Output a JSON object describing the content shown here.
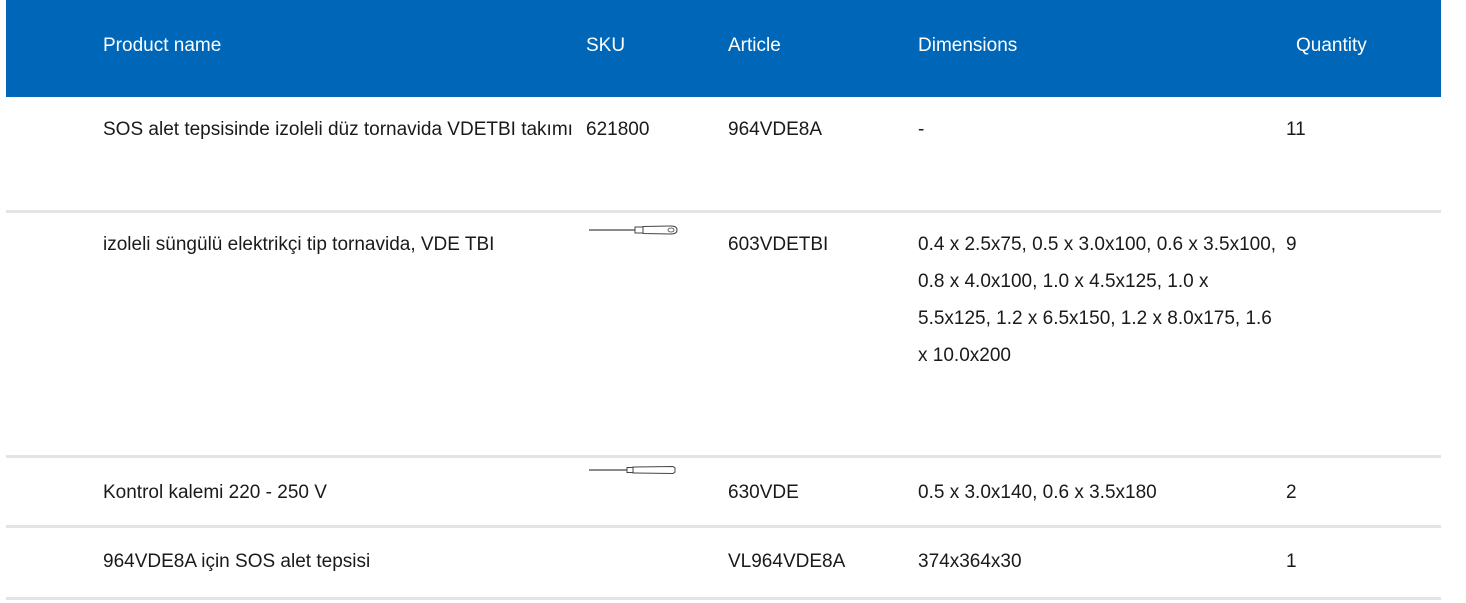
{
  "header": {
    "product_name": "Product name",
    "sku": "SKU",
    "article": "Article",
    "dimensions": "Dimensions",
    "quantity": "Quantity"
  },
  "rows": [
    {
      "name": "SOS alet tepsisinde izoleli düz tornavida VDETBI takımı",
      "sku": "621800",
      "article": "964VDE8A",
      "dimensions": "-",
      "quantity": "11",
      "icon": null
    },
    {
      "name": "izoleli süngülü elektrikçi tip tornavida, VDE TBI",
      "sku": "",
      "article": "603VDETBI",
      "dimensions": "0.4 x 2.5x75, 0.5 x 3.0x100, 0.6 x 3.5x100, 0.8 x 4.0x100, 1.0 x 4.5x125, 1.0 x 5.5x125, 1.2 x 6.5x150, 1.2 x 8.0x175, 1.6 x 10.0x200",
      "quantity": "9",
      "icon": "screwdriver-icon"
    },
    {
      "name": "Kontrol kalemi 220 - 250 V",
      "sku": "",
      "article": "630VDE",
      "dimensions": "0.5 x 3.0x140, 0.6 x 3.5x180",
      "quantity": "2",
      "icon": "voltage-tester-icon"
    },
    {
      "name": "964VDE8A için SOS alet tepsisi",
      "sku": "",
      "article": "VL964VDE8A",
      "dimensions": "374x364x30",
      "quantity": "1",
      "icon": null
    }
  ],
  "colors": {
    "header_bg": "#0067b8",
    "header_text": "#ffffff",
    "row_divider": "#e4e4e4",
    "body_text": "#1a1a1a"
  }
}
